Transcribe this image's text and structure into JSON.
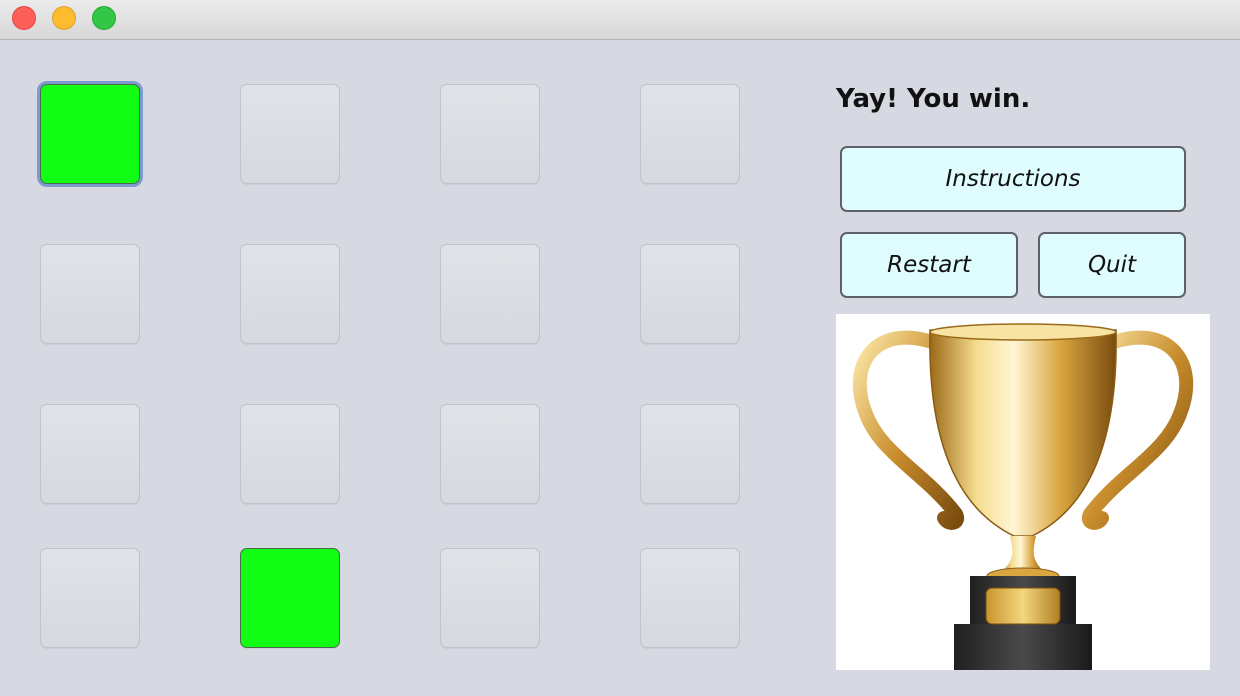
{
  "window": {
    "controls": [
      "close",
      "minimize",
      "maximize"
    ]
  },
  "board": {
    "rows": 4,
    "columns": 4,
    "cells": [
      {
        "lit": true,
        "focused": true
      },
      {
        "lit": false
      },
      {
        "lit": false
      },
      {
        "lit": false
      },
      {
        "lit": false
      },
      {
        "lit": false
      },
      {
        "lit": false
      },
      {
        "lit": false
      },
      {
        "lit": false
      },
      {
        "lit": false
      },
      {
        "lit": false
      },
      {
        "lit": false
      },
      {
        "lit": false
      },
      {
        "lit": true
      },
      {
        "lit": false
      },
      {
        "lit": false
      }
    ],
    "lit_color": "#12fe15"
  },
  "status": {
    "message": "Yay! You win."
  },
  "buttons": {
    "instructions": "Instructions",
    "restart": "Restart",
    "quit": "Quit",
    "background_color": "#dffcfe"
  },
  "image": {
    "icon": "trophy-icon"
  }
}
